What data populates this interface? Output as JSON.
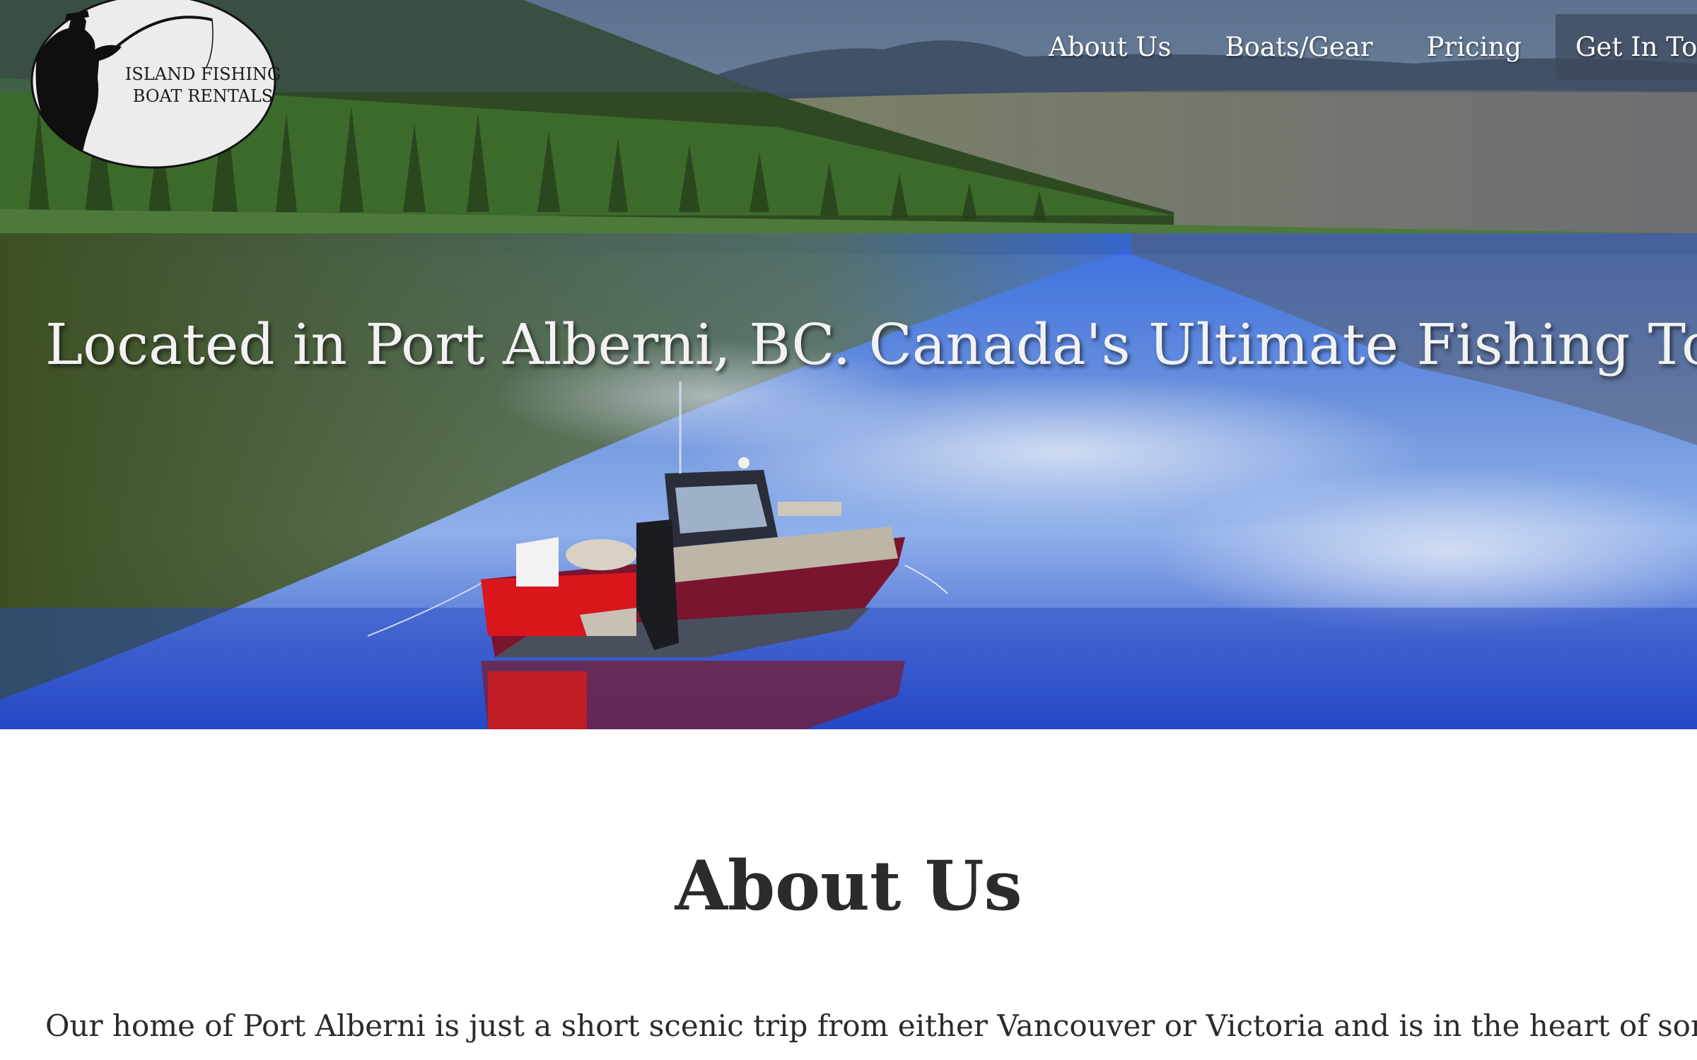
{
  "brand": {
    "logo_line1": "ISLAND FISHING",
    "logo_line2": "BOAT RENTALS"
  },
  "nav": {
    "items": [
      {
        "label": "About Us"
      },
      {
        "label": "Boats/Gear"
      },
      {
        "label": "Pricing"
      },
      {
        "label": "Get In Touch"
      }
    ]
  },
  "hero": {
    "headline": "Located in Port Alberni, BC. Canada's Ultimate Fishing Town"
  },
  "about": {
    "title": "About Us",
    "paragraph": "Our home of Port Alberni is just a short scenic trip from either Vancouver or Victoria and is in the heart of some of"
  },
  "colors": {
    "nav_text": "#ffffff",
    "heading_text": "#2b2b2b",
    "body_text": "#2b2b2b",
    "headline_text": "#f2f2f2",
    "lake_blue": "#2a5bd8"
  }
}
